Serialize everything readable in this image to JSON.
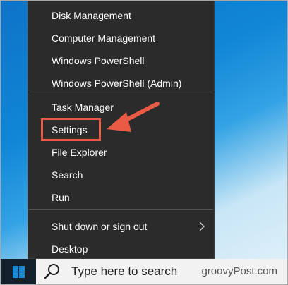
{
  "menu": {
    "items": [
      {
        "label": "Disk Management"
      },
      {
        "label": "Computer Management"
      },
      {
        "label": "Windows PowerShell"
      },
      {
        "label": "Windows PowerShell (Admin)"
      },
      {
        "label": "Task Manager"
      },
      {
        "label": "Settings"
      },
      {
        "label": "File Explorer"
      },
      {
        "label": "Search"
      },
      {
        "label": "Run"
      },
      {
        "label": "Shut down or sign out"
      },
      {
        "label": "Desktop"
      }
    ]
  },
  "taskbar": {
    "search_placeholder": "Type here to search"
  },
  "watermark": "groovyPost.com",
  "colors": {
    "menu_bg": "#2b2b2b",
    "highlight": "#ea5a45",
    "taskbar": "#12212c",
    "windows_blue": "#1a8ad4"
  },
  "icons": [
    "windows-logo-icon",
    "search-icon",
    "chevron-right-icon",
    "arrow-annotation"
  ]
}
